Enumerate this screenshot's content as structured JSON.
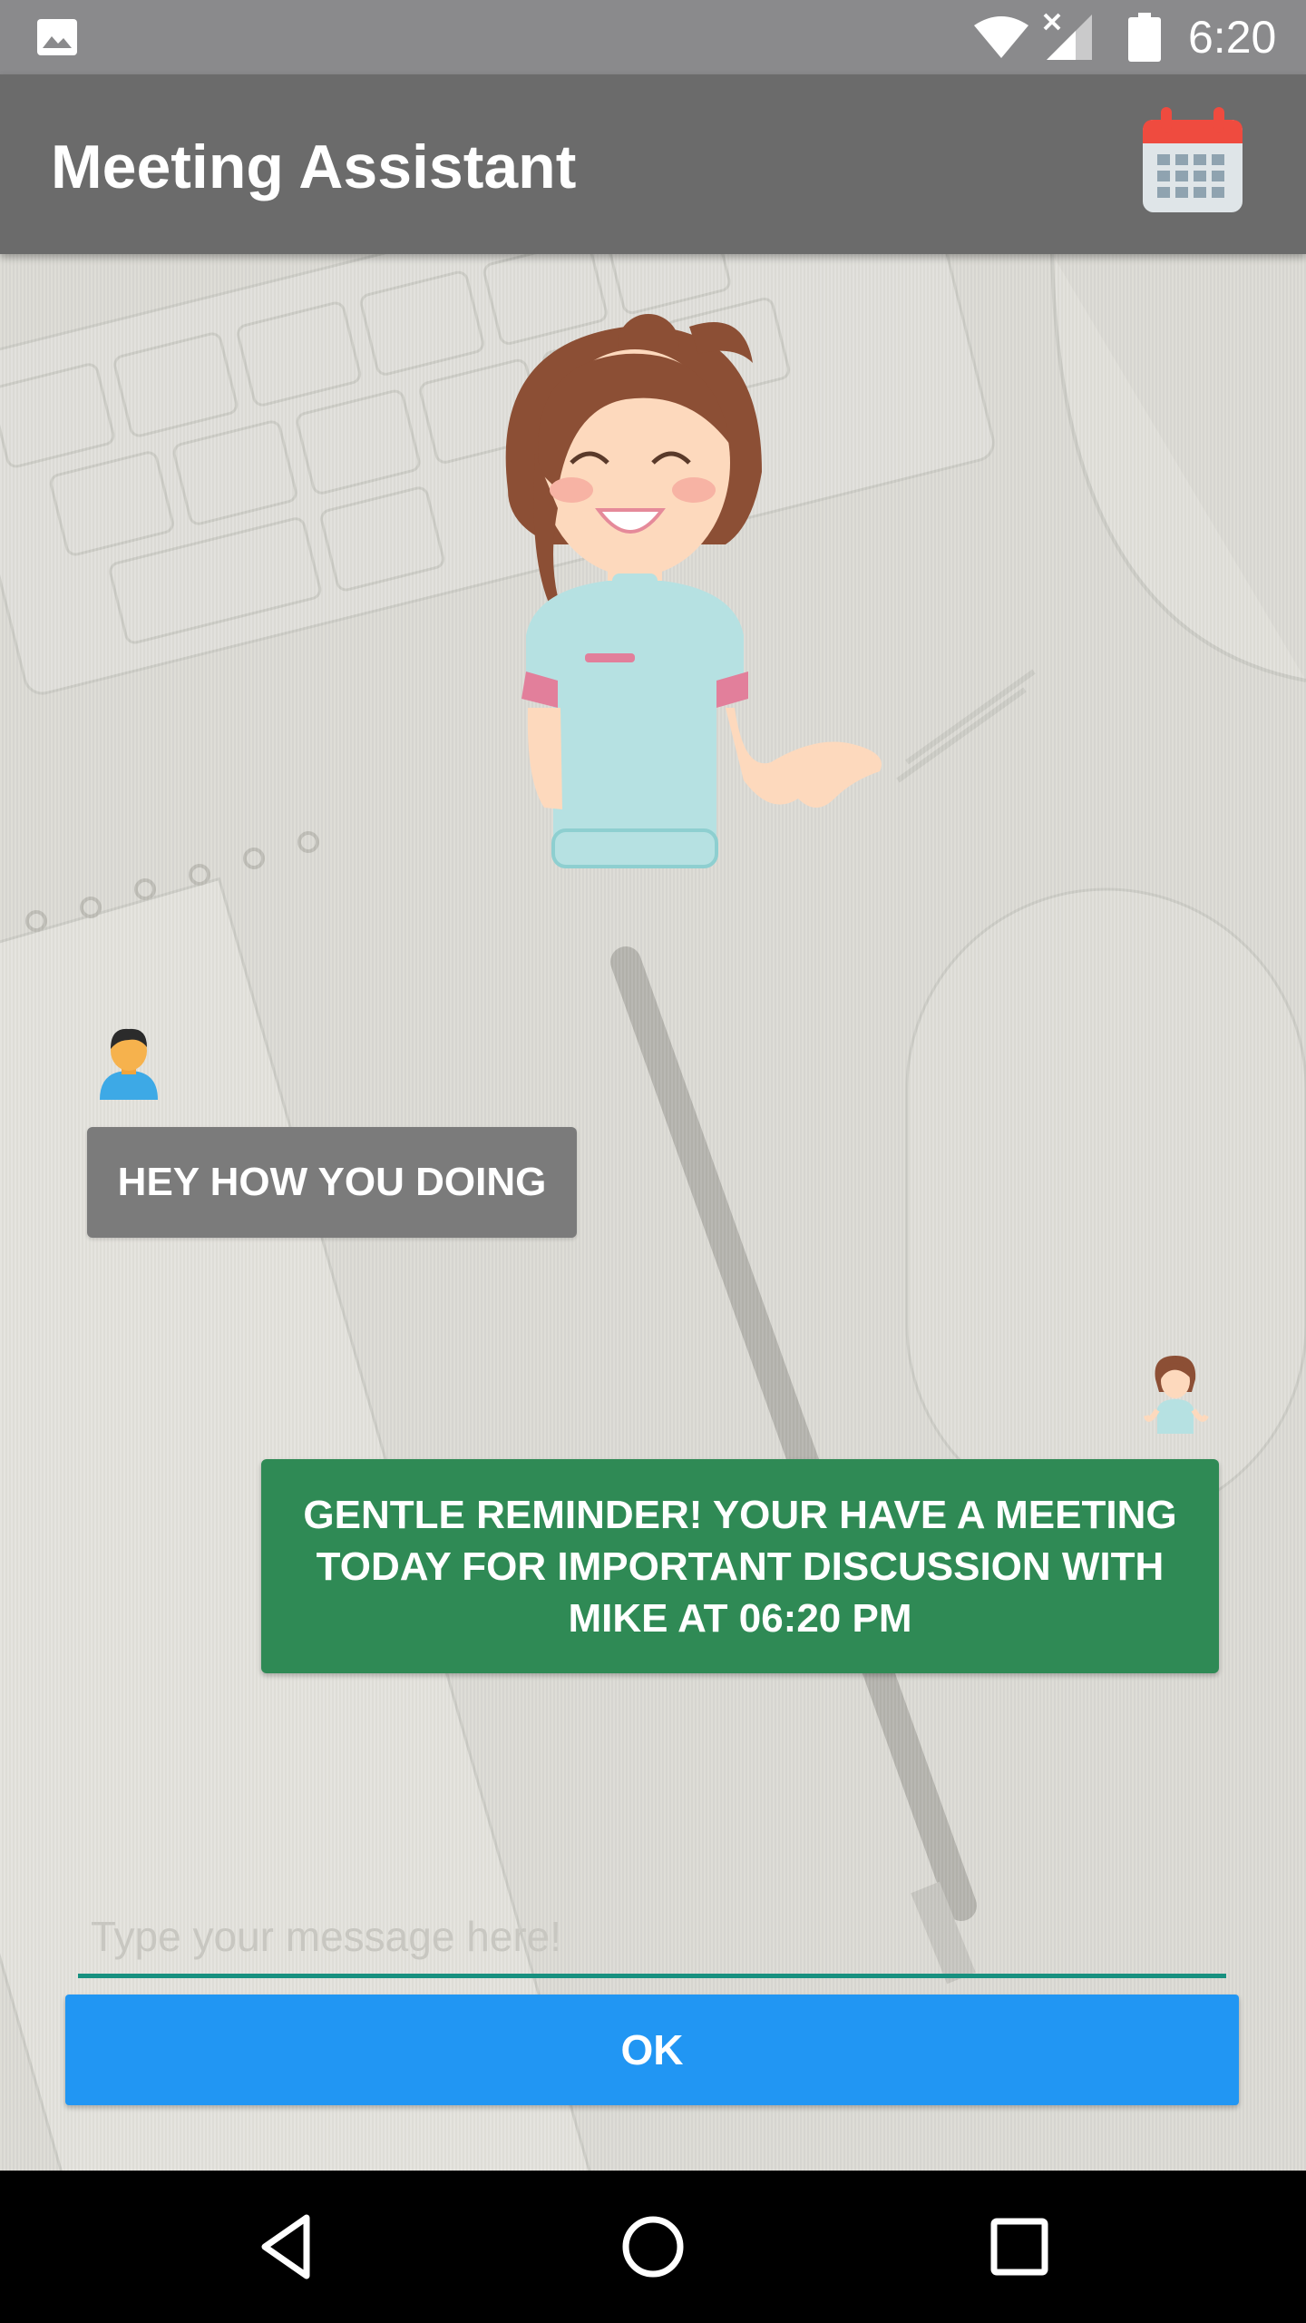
{
  "status_bar": {
    "time": "6:20",
    "icons": [
      "gallery-icon",
      "wifi-icon",
      "signal-icon",
      "battery-icon"
    ]
  },
  "app_bar": {
    "title": "Meeting Assistant",
    "action_icon": "calendar-icon",
    "calendar_red": "#ef4b3f",
    "calendar_grid": "#8fa3b0"
  },
  "chat": {
    "messages": [
      {
        "sender": "user",
        "avatar": "user-avatar",
        "text": "HEY HOW YOU DOING",
        "bubble_color": "#7b7b7b"
      },
      {
        "sender": "assistant",
        "avatar": "assistant-avatar",
        "text": "GENTLE REMINDER! YOUR HAVE A MEETING TODAY FOR IMPORTANT DISCUSSION WITH MIKE AT 06:20 PM",
        "bubble_color": "#2f8a55"
      }
    ]
  },
  "composer": {
    "placeholder": "Type your message here!",
    "value": "",
    "underline_color": "#17907f",
    "button_label": "OK",
    "button_color": "#2196f3"
  },
  "nav_bar": {
    "buttons": [
      "back-icon",
      "home-icon",
      "recents-icon"
    ]
  }
}
